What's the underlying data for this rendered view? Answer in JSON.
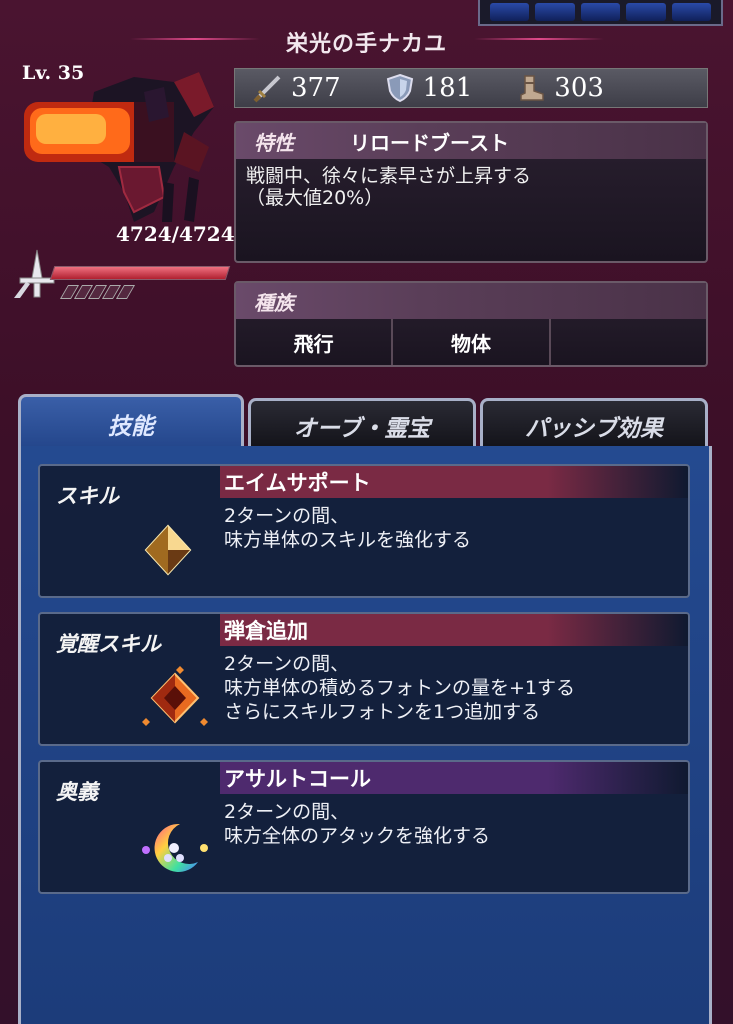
{
  "header": {
    "title": "栄光の手ナカユ"
  },
  "unit": {
    "level": "Lv. 35",
    "hp_text": "4724/4724",
    "hp_fraction": 1.0
  },
  "stats": [
    {
      "icon": "sword-icon",
      "value": "377"
    },
    {
      "icon": "shield-icon",
      "value": "181"
    },
    {
      "icon": "boot-icon",
      "value": "303"
    }
  ],
  "trait": {
    "label": "特性",
    "name": "リロードブースト",
    "desc_line1": "戦闘中、徐々に素早さが上昇する",
    "desc_line2": "（最大値20%）"
  },
  "race": {
    "label": "種族",
    "cells": [
      "飛行",
      "物体",
      ""
    ]
  },
  "tabs": [
    {
      "label": "技能",
      "active": true
    },
    {
      "label": "オーブ・霊宝",
      "active": false
    },
    {
      "label": "パッシブ効果",
      "active": false
    }
  ],
  "skills": [
    {
      "type": "スキル",
      "name": "エイムサポート",
      "desc": [
        "2ターンの間、",
        "味方単体のスキルを強化する"
      ],
      "bar_color": "#7a2a44"
    },
    {
      "type": "覚醒スキル",
      "name": "弾倉追加",
      "desc": [
        "2ターンの間、",
        "味方単体の積めるフォトンの量を+1する",
        "さらにスキルフォトンを1つ追加する"
      ],
      "bar_color": "#7a2a44"
    },
    {
      "type": "奥義",
      "name": "アサルトコール",
      "desc": [
        "2ターンの間、",
        "味方全体のアタックを強化する"
      ],
      "bar_color": "#4e2a6e"
    }
  ]
}
